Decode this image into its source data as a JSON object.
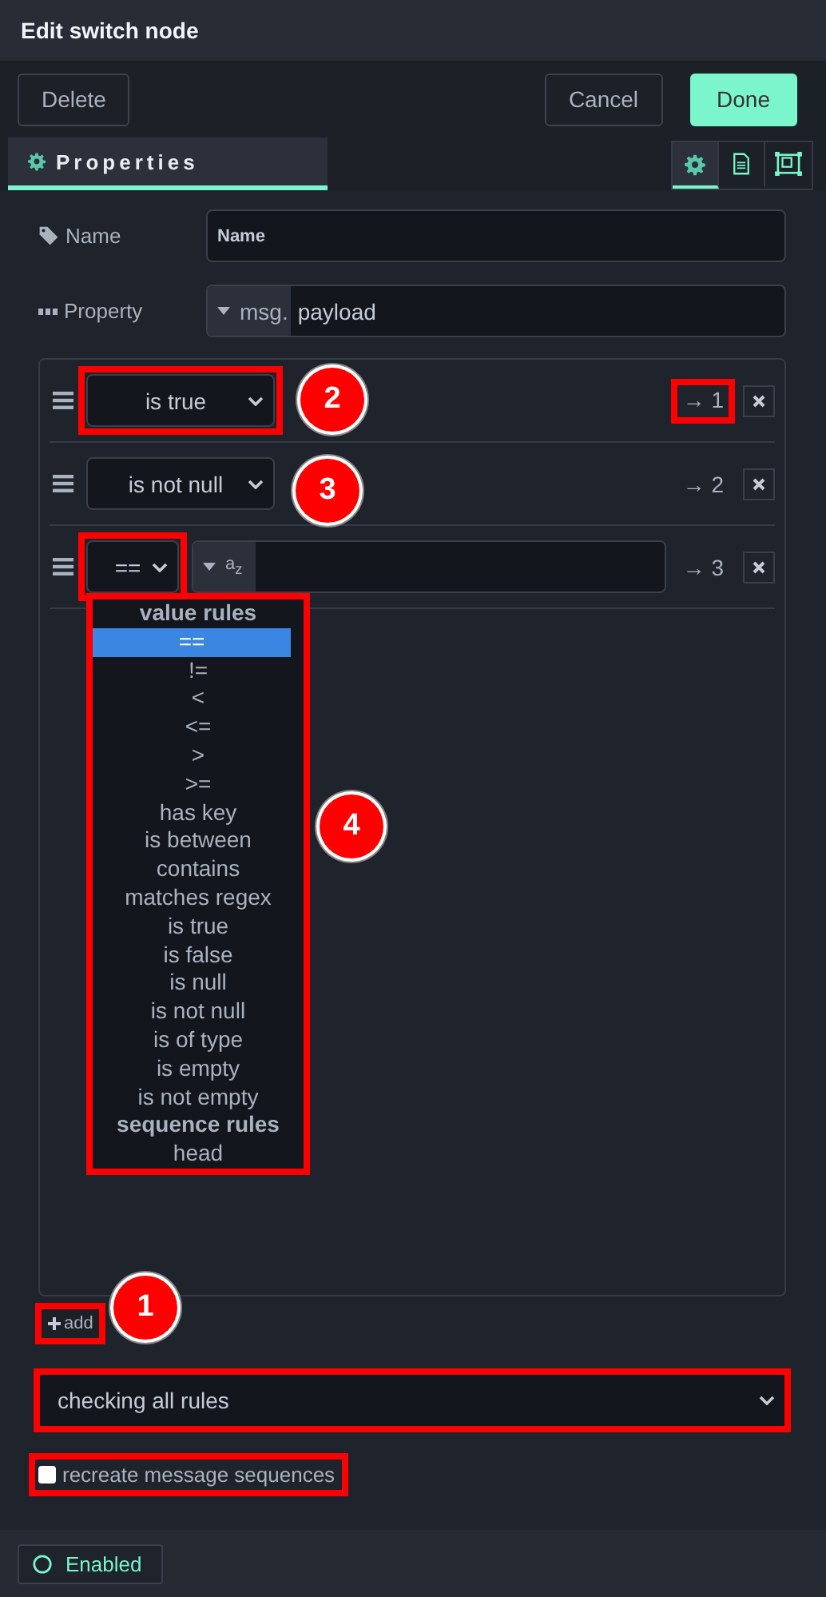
{
  "window": {
    "title": "Edit switch node"
  },
  "actions": [
    {
      "label": "Delete",
      "kind": "plain"
    },
    {
      "label": "Cancel",
      "kind": "plain"
    },
    {
      "label": "Done",
      "kind": "primary"
    }
  ],
  "tab": {
    "label": "Properties",
    "selected": true
  },
  "side_tabs": [
    {
      "kind": "gear",
      "selected": true
    },
    {
      "kind": "doc",
      "selected": false
    },
    {
      "kind": "frame",
      "selected": false
    }
  ],
  "name_field": {
    "label": "Name",
    "value": "Name"
  },
  "property_field": {
    "label": "Property",
    "prefix": "msg.",
    "value": "payload"
  },
  "rules": [
    {
      "operator": "is true",
      "port": "→ 1",
      "highlighted": true,
      "port_highlighted": true
    },
    {
      "operator": "is not null",
      "port": "→ 2",
      "highlighted": false,
      "port_highlighted": false
    },
    {
      "operator": "==",
      "port": "→ 3",
      "highlighted": true,
      "port_highlighted": false,
      "value_type": "a$_{z}$",
      "open": true
    }
  ],
  "dropdown": {
    "highlighted": true,
    "options": [
      {
        "kind": "group",
        "label": "value rules",
        "selected": false
      },
      {
        "kind": "option",
        "label": "==",
        "selected": true
      },
      {
        "kind": "option",
        "label": "!=",
        "selected": false
      },
      {
        "kind": "option",
        "label": "<",
        "selected": false
      },
      {
        "kind": "option",
        "label": "<=",
        "selected": false
      },
      {
        "kind": "option",
        "label": ">",
        "selected": false
      },
      {
        "kind": "option",
        "label": ">=",
        "selected": false
      },
      {
        "kind": "option",
        "label": "has key",
        "selected": false
      },
      {
        "kind": "option",
        "label": "is between",
        "selected": false
      },
      {
        "kind": "option",
        "label": "contains",
        "selected": false
      },
      {
        "kind": "option",
        "label": "matches regex",
        "selected": false
      },
      {
        "kind": "option",
        "label": "is true",
        "selected": false
      },
      {
        "kind": "option",
        "label": "is false",
        "selected": false
      },
      {
        "kind": "option",
        "label": "is null",
        "selected": false
      },
      {
        "kind": "option",
        "label": "is not null",
        "selected": false
      },
      {
        "kind": "option",
        "label": "is of type",
        "selected": false
      },
      {
        "kind": "option",
        "label": "is empty",
        "selected": false
      },
      {
        "kind": "option",
        "label": "is not empty",
        "selected": false
      },
      {
        "kind": "group",
        "label": "sequence rules",
        "selected": false
      },
      {
        "kind": "option",
        "label": "head",
        "selected": false
      }
    ]
  },
  "add_button": {
    "label": "add",
    "highlighted": true
  },
  "mode_select": {
    "value": "checking all rules",
    "highlighted": true
  },
  "recreate_sequences": {
    "label": "recreate message sequences",
    "checked": false,
    "highlighted": true
  },
  "status": {
    "label": "Enabled"
  },
  "annotations": [
    "1",
    "2",
    "3",
    "4"
  ]
}
